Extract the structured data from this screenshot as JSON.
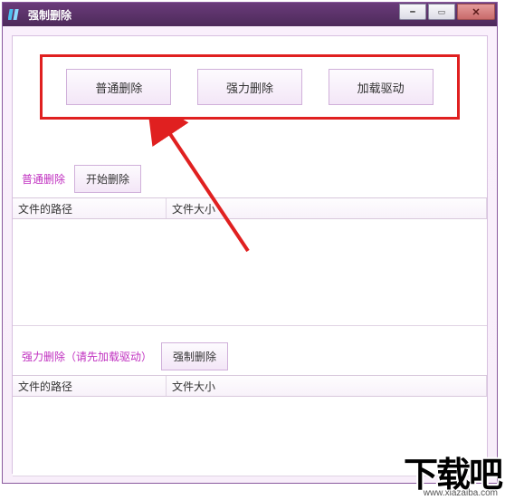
{
  "window": {
    "title": "强制删除"
  },
  "top_buttons": {
    "normal_delete": "普通删除",
    "force_delete": "强力删除",
    "load_driver": "加载驱动"
  },
  "section1": {
    "label": "普通删除",
    "button": "开始删除",
    "columns": {
      "path": "文件的路径",
      "size": "文件大小"
    }
  },
  "section2": {
    "label": "强力删除（请先加载驱动）",
    "button": "强制删除",
    "columns": {
      "path": "文件的路径",
      "size": "文件大小"
    }
  },
  "watermark": {
    "text": "下载吧",
    "url": "www.xiazaiba.com"
  }
}
